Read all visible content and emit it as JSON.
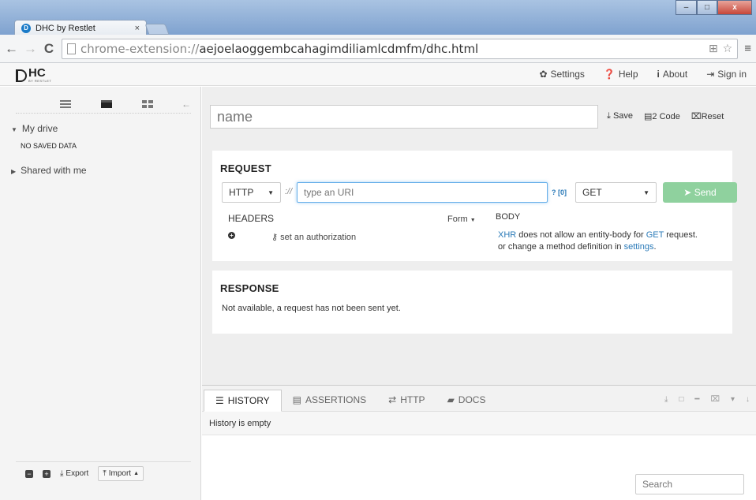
{
  "browser": {
    "tab_title": "DHC by Restlet",
    "tab_close": "×",
    "url_scheme": "chrome-extension://",
    "url_rest": "aejoelaoggembcahagimdiliamlcdmfm/dhc.html",
    "nav_back": "←",
    "nav_forward": "→",
    "nav_reload": "C",
    "window_min": "–",
    "window_max": "□",
    "window_close": "x"
  },
  "header": {
    "logo_text": "HC",
    "logo_sub": "BY RESTLET",
    "links": {
      "settings": "Settings",
      "help": "Help",
      "about": "About",
      "signin": "Sign in"
    }
  },
  "sidebar": {
    "my_drive": "My drive",
    "no_saved": "NO SAVED DATA",
    "shared": "Shared with me",
    "export": "Export",
    "import": "Import"
  },
  "request_bar": {
    "name_placeholder": "name",
    "save": "Save",
    "to_code": "2 Code",
    "reset": "Reset"
  },
  "request": {
    "title": "REQUEST",
    "protocol": "HTTP",
    "separator": "://",
    "uri_placeholder": "type an URI",
    "uri_help": "? [0]",
    "method": "GET",
    "send": "Send",
    "headers_label": "HEADERS",
    "form_label": "Form",
    "body_label": "BODY",
    "auth_link": "set an authorization",
    "body_msg_xhr": "XHR",
    "body_msg_1": " does not allow an entity-body for ",
    "body_msg_get": "GET",
    "body_msg_2": " request.",
    "body_msg_3": "or change a method definition in ",
    "body_msg_settings": "settings",
    "body_msg_end": "."
  },
  "response": {
    "title": "RESPONSE",
    "message": "Not available, a request has not been sent yet."
  },
  "bottom": {
    "tabs": [
      "HISTORY",
      "ASSERTIONS",
      "HTTP",
      "DOCS"
    ],
    "history_empty": "History is empty",
    "search_placeholder": "Search"
  },
  "colors": {
    "accent": "#2a7ab8",
    "send_button": "#8fd19e"
  }
}
